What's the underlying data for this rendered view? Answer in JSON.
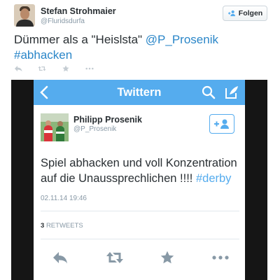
{
  "outer_tweet": {
    "author_name": "Stefan Strohmaier",
    "author_handle": "@Fluridsdurfa",
    "follow_label": "Folgen",
    "text_plain": "Dümmer als a \"Heislsta\" ",
    "mention": "@P_Prosenik",
    "hashtag": "#abhacken",
    "actions": [
      "reply-icon",
      "retweet-icon",
      "favorite-icon",
      "more-icon"
    ]
  },
  "screenshot": {
    "app_bar": {
      "title": "Twittern",
      "icons": [
        "back-icon",
        "search-icon",
        "compose-icon"
      ]
    },
    "tweet": {
      "author_name": "Philipp Prosenik",
      "author_handle": "@P_Prosenik",
      "text_plain": "Spiel abhacken und voll Konzentration auf die Unaussprechlichen !!!! ",
      "hashtag": "#derby",
      "timestamp": "02.11.14 19:46",
      "retweet_count": "3",
      "retweet_label": "RETWEETS",
      "actions": [
        "reply-icon",
        "retweet-icon",
        "favorite-icon",
        "more-icon"
      ]
    }
  },
  "colors": {
    "twitter_blue": "#55acee",
    "link_blue": "#2a86c8",
    "text": "#292f33",
    "muted": "#8899a6",
    "action_gray": "#c4ccd2"
  }
}
